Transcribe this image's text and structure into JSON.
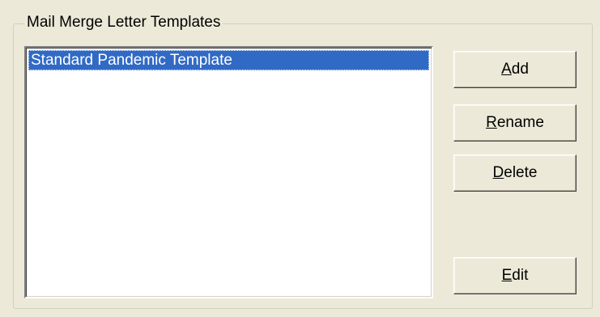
{
  "group": {
    "title": "Mail Merge Letter Templates"
  },
  "templates": {
    "items": [
      {
        "label": "Standard Pandemic Template",
        "selected": true
      }
    ]
  },
  "buttons": {
    "add": {
      "mnemonic": "A",
      "rest": "dd"
    },
    "rename": {
      "mnemonic": "R",
      "rest": "ename"
    },
    "delete": {
      "mnemonic": "D",
      "rest": "elete"
    },
    "edit": {
      "mnemonic": "E",
      "rest": "dit"
    }
  },
  "colors": {
    "window_bg": "#ECE9D8",
    "selection_bg": "#316AC5",
    "selection_text": "#FFFFFF"
  }
}
